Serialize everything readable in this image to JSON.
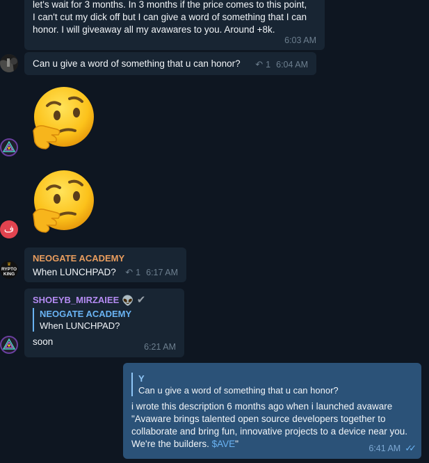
{
  "messages": {
    "m1": {
      "line1": "let's wait for 3 months. In 3 months if the price comes to this point,",
      "line2": "I can't cut my dick off but I can give a word of something that I can",
      "line3": "honor. I will giveaway all my avawares to you. Around +8k.",
      "time": "6:03 AM"
    },
    "m2": {
      "text": "Can u give a word of something that u can honor?",
      "replies": "1",
      "time": "6:04 AM"
    },
    "m3": {
      "emoji": "thinking-face"
    },
    "m4": {
      "emoji": "thinking-face",
      "avatar_letter": "ف"
    },
    "m5": {
      "sender": "NEOGATE ACADEMY",
      "text": "When LUNCHPAD?",
      "replies": "1",
      "time": "6:17 AM",
      "avatar_text_1": "RYPTO",
      "avatar_text_2": "KING"
    },
    "m6": {
      "sender": "SHOEYB_MIRZAIEE",
      "quote_sender": "NEOGATE ACADEMY",
      "quote_text": "When LUNCHPAD?",
      "text": "soon",
      "time": "6:21 AM"
    },
    "m7": {
      "quote_sender": "Y",
      "quote_text": "Can u give a word of something that u can honor?",
      "line1": "i wrote this description 6 months ago when i launched avaware",
      "line2": "\"Avaware brings talented open source developers together to",
      "line3": "collaborate and bring fun, innovative projects to a device near you.",
      "line4_text": "We're the builders.",
      "line4_link": "$AVE",
      "line4_end": "\"",
      "time": "6:41 AM"
    }
  },
  "colors": {
    "background": "#0e1621",
    "incoming_bubble": "#182533",
    "outgoing_bubble": "#2b5278",
    "neogate_name": "#e99d5e",
    "shoeyb_name": "#b48bf2",
    "link": "#6ab3f3"
  }
}
